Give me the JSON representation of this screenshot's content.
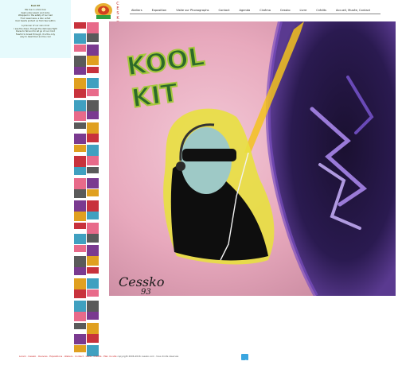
{
  "poem": {
    "title": "Kool Kit",
    "stanza1": [
      "We live in a Kool box",
      "Kept under alarm and locks",
      "Wrapped in the safety of our bed",
      "From weariness, a Zen unfed",
      "Kool hearts protect us from fear within"
    ],
    "stanza2": [
      "A prisoner of our own mind",
      "I see the dawn, though the darkness fight",
      "Dares to fall and to let go of our mind",
      "Fearful to break through, it is the only",
      "way to dwell Kool and be cool"
    ]
  },
  "logo": {
    "letters": [
      "C",
      "E",
      "S",
      "K",
      "O"
    ]
  },
  "nav": {
    "items": [
      "Ateliers",
      "Exposition",
      "Visite sur Phonographs",
      "Contact",
      "Agenda",
      "Cinéma",
      "Cessko",
      "Livre",
      "Crédits",
      "Accueil, Musée, Contact"
    ]
  },
  "footer": {
    "links": "Lorem · Cessko · Oeuvres · Expositions · Ateliers · Contact · Liens · Crédits · Plan du site",
    "copyright": "copyright 2006-2016 cessko.com · tous droits réservés"
  },
  "painting": {
    "caption_title": "KOOL KIT",
    "signature": "Cessko 93"
  },
  "colors": {
    "poem_bg": "#e6fafc",
    "nav_text": "#222222",
    "footer_red": "#cc2020"
  }
}
